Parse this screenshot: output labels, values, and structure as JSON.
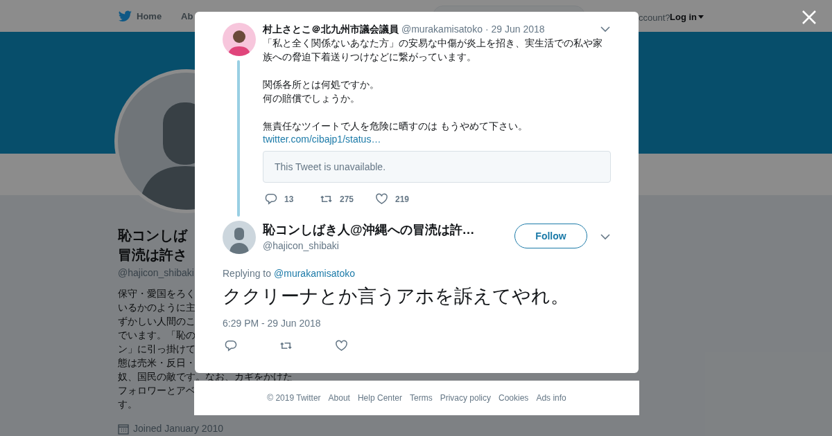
{
  "nav": {
    "items": [
      {
        "label": "Home",
        "kind": "home"
      },
      {
        "label": "Ab",
        "kind": "plain"
      }
    ],
    "account_prompt": "ccount?",
    "login": "Log in"
  },
  "profile": {
    "name_lines": [
      "恥コンしば",
      "冒涜は許さ"
    ],
    "handle": "@hajicon_shibaki",
    "bio_lines": [
      "保守・愛国をろく",
      "いるかのように主",
      "ずかしい人間のこ",
      "でいます。「恥の",
      "ン」に引っ掛けて",
      "態は売米・反日・",
      "奴、国民の敵です。なお、カギをかけた",
      "フォロワーとアベ",
      "す。"
    ],
    "joined": "Joined January 2010"
  },
  "quoted_reply": {
    "name": "村上さとこ＠北九州市議会議員",
    "handle": "@murakamisatoko",
    "date": "· 29 Jun 2018",
    "paragraphs": [
      [
        "「私と全く関係ないあなた方」の安易な中傷が炎上を招き、実生活での私や家族への脅迫下着送りつけなどに繋がっています。"
      ],
      [
        "関係各所とは何処ですか。",
        "何の賠償でしょうか。"
      ],
      [
        "無責任なツイートで人を危険に晒すのは もうやめて下さい。"
      ]
    ],
    "link": "twitter.com/cibajp1/status…",
    "quote": "This Tweet is unavailable.",
    "actions": [
      {
        "kind": "reply",
        "count": "13"
      },
      {
        "kind": "retweet",
        "count": "275"
      },
      {
        "kind": "like",
        "count": "219"
      }
    ]
  },
  "tweet": {
    "name": "恥コンしばき人@沖縄への冒涜は許…",
    "handle": "@hajicon_shibaki",
    "follow": "Follow",
    "replying_label": "Replying to",
    "replying_to": "@murakamisatoko",
    "text": "ククリーナとか言うアホを訴えてやれ。",
    "time": "6:29 PM - 29 Jun 2018",
    "actions": [
      {
        "kind": "reply"
      },
      {
        "kind": "retweet"
      },
      {
        "kind": "like"
      }
    ]
  },
  "footer": {
    "links": [
      "© 2019 Twitter",
      "About",
      "Help Center",
      "Terms",
      "Privacy policy",
      "Cookies",
      "Ads info"
    ]
  }
}
